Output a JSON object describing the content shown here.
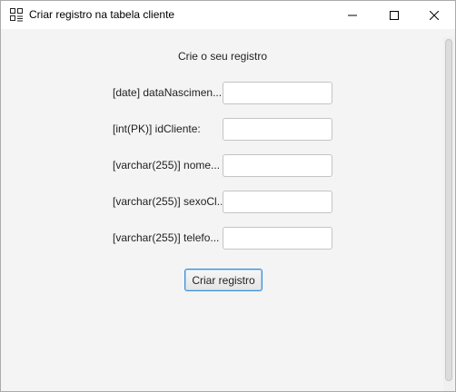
{
  "window": {
    "title": "Criar registro na tabela cliente",
    "app_icon": "table-icon",
    "controls": [
      "minimize-icon",
      "maximize-icon",
      "close-icon"
    ]
  },
  "form": {
    "heading": "Crie o seu registro",
    "fields": [
      {
        "label": "[date] dataNascimen...",
        "value": ""
      },
      {
        "label": "[int(PK)] idCliente:",
        "value": ""
      },
      {
        "label": "[varchar(255)] nome...",
        "value": ""
      },
      {
        "label": "[varchar(255)] sexoCl...",
        "value": ""
      },
      {
        "label": "[varchar(255)] telefo...",
        "value": ""
      }
    ],
    "submit_label": "Criar registro"
  },
  "colors": {
    "focus_accent": "#3c8fd8",
    "window_background": "#f4f4f4"
  }
}
